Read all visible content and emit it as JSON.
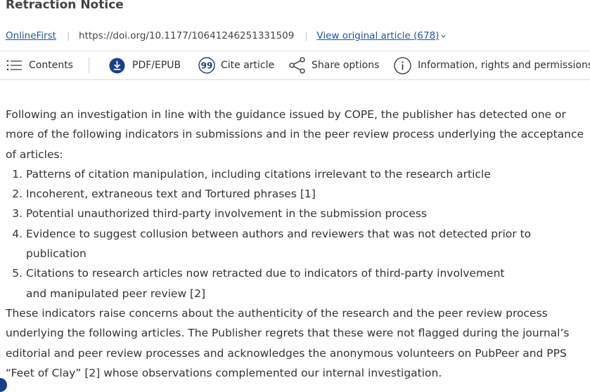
{
  "article": {
    "title": "Retraction Notice",
    "section_link": "OnlineFirst",
    "separator": "|",
    "doi": "https://doi.org/10.1177/10641246251331509",
    "original_link": "View original article (678)"
  },
  "toolbar": {
    "contents": "Contents",
    "pdf": "PDF/EPUB",
    "cite": "Cite article",
    "share": "Share options",
    "info": "Information, rights and permissions"
  },
  "notice": {
    "intro": "Following an investigation in line with the guidance issued by COPE, the publisher has detected one or more of the following indicators in submissions and in the peer review process underlying the acceptance of articles:",
    "indicators": [
      "Patterns of citation manipulation, including citations irrelevant to the research article",
      "Incoherent, extraneous text and Tortured phrases [1]",
      "Potential unauthorized third-party involvement in the submission process",
      "Evidence to suggest collusion between authors and reviewers that was not detected prior to publication",
      "Citations to research articles now retracted due to indicators of third-party involvement and manipulated peer review [2]"
    ],
    "closing": "These indicators raise concerns about the authenticity of the research and the peer review process underlying the following articles. The Publisher regrets that these were not flagged during the journal’s editorial and peer review processes and acknowledges the anonymous volunteers on PubPeer and PPS “Feet of Clay” [2] whose observations complemented our internal investigation."
  },
  "colors": {
    "link": "#1a56a8",
    "icon_dark": "#1a3f8a",
    "text": "#333333"
  },
  "icons": {
    "contents": "list-icon",
    "pdf": "download-icon",
    "cite": "quote-icon",
    "share": "share-icon",
    "info": "info-icon"
  }
}
